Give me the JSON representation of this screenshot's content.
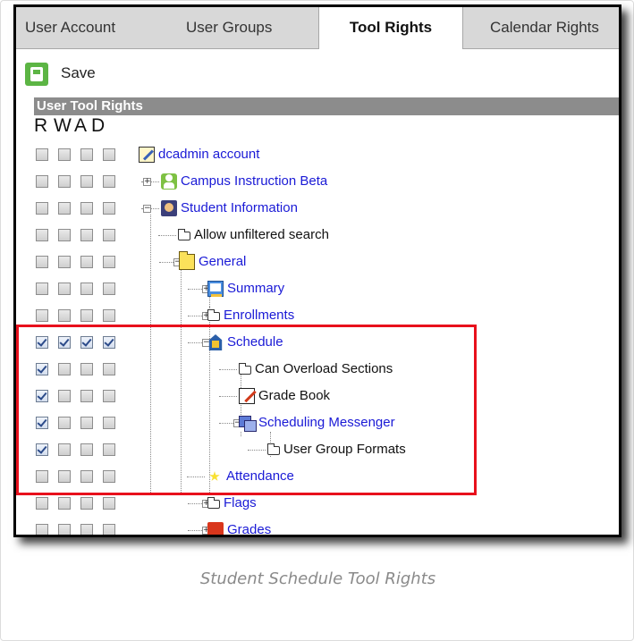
{
  "tabs": [
    {
      "label": "User Account",
      "active": false
    },
    {
      "label": "User Groups",
      "active": false
    },
    {
      "label": "Tool Rights",
      "active": true
    },
    {
      "label": "Calendar Rights",
      "active": false
    }
  ],
  "toolbar": {
    "save_label": "Save"
  },
  "section_header": "User Tool Rights",
  "rights_columns": [
    "R",
    "W",
    "A",
    "D"
  ],
  "tree_rows": [
    {
      "label": "dcadmin account",
      "checked": [
        false,
        false,
        false,
        false
      ],
      "link": true
    },
    {
      "label": "Campus Instruction Beta",
      "checked": [
        false,
        false,
        false,
        false
      ],
      "link": true
    },
    {
      "label": "Student Information",
      "checked": [
        false,
        false,
        false,
        false
      ],
      "link": true
    },
    {
      "label": "Allow unfiltered search",
      "checked": [
        false,
        false,
        false,
        false
      ],
      "link": false
    },
    {
      "label": "General",
      "checked": [
        false,
        false,
        false,
        false
      ],
      "link": true
    },
    {
      "label": "Summary",
      "checked": [
        false,
        false,
        false,
        false
      ],
      "link": true
    },
    {
      "label": "Enrollments",
      "checked": [
        false,
        false,
        false,
        false
      ],
      "link": true
    },
    {
      "label": "Schedule",
      "checked": [
        true,
        true,
        true,
        true
      ],
      "link": true
    },
    {
      "label": "Can Overload Sections",
      "checked": [
        true,
        false,
        false,
        false
      ],
      "link": false
    },
    {
      "label": "Grade Book",
      "checked": [
        true,
        false,
        false,
        false
      ],
      "link": false
    },
    {
      "label": "Scheduling Messenger",
      "checked": [
        true,
        false,
        false,
        false
      ],
      "link": true
    },
    {
      "label": "User Group Formats",
      "checked": [
        true,
        false,
        false,
        false
      ],
      "link": false
    },
    {
      "label": "Attendance",
      "checked": [
        false,
        false,
        false,
        false
      ],
      "link": true
    },
    {
      "label": "Flags",
      "checked": [
        false,
        false,
        false,
        false
      ],
      "link": true
    },
    {
      "label": "Grades",
      "checked": [
        false,
        false,
        false,
        false
      ],
      "link": true
    }
  ],
  "caption": "Student Schedule Tool Rights",
  "colors": {
    "highlight": "#e8101c",
    "link": "#1a1ad6",
    "section_header_bg": "#8c8c8c",
    "save_icon": "#5cb544"
  }
}
